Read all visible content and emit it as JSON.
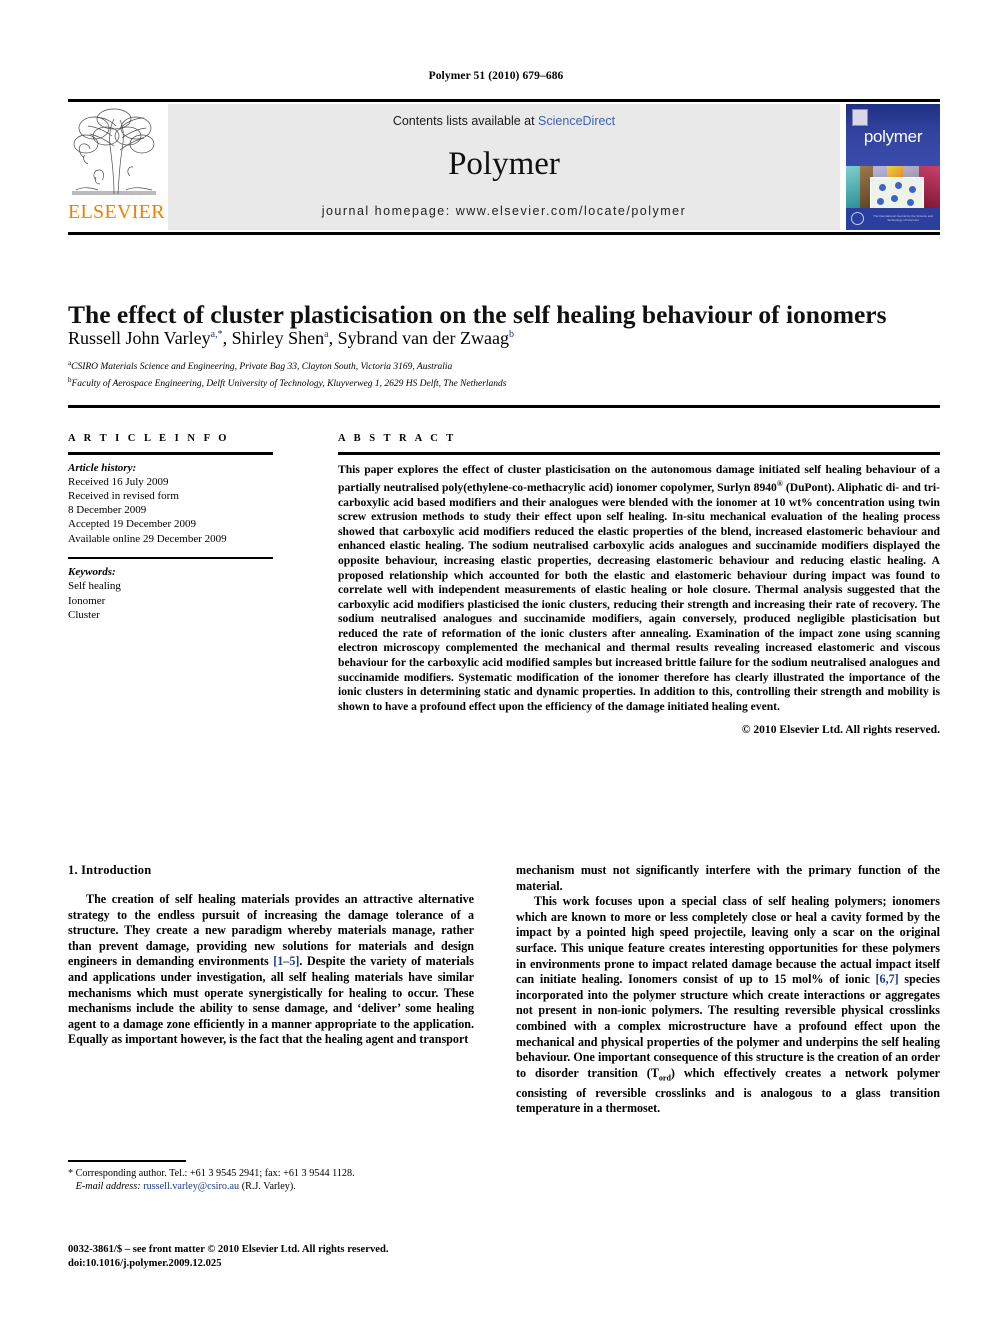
{
  "running_head": "Polymer 51 (2010) 679–686",
  "masthead": {
    "contents_prefix": "Contents lists available at ",
    "sciencedirect": "ScienceDirect",
    "journal_name": "Polymer",
    "homepage": "journal homepage: www.elsevier.com/locate/polymer",
    "publisher": "ELSEVIER",
    "cover_title": "polymer",
    "cover_footer": "The International Journal for the Science and Technology of Polymers",
    "link_color": "#3c63ae",
    "publisher_color": "#f08000",
    "banner_bg": "#e9e9e9",
    "cover_bg": "#2a3f9e"
  },
  "article": {
    "title": "The effect of cluster plasticisation on the self healing behaviour of ionomers",
    "authors": [
      {
        "name": "Russell John Varley",
        "marks": "a,*"
      },
      {
        "name": "Shirley Shen",
        "marks": "a"
      },
      {
        "name": "Sybrand van der Zwaag",
        "marks": "b"
      }
    ],
    "affiliations": [
      {
        "mark": "a",
        "text": "CSIRO Materials Science and Engineering, Private Bag 33, Clayton South, Victoria 3169, Australia"
      },
      {
        "mark": "b",
        "text": "Faculty of Aerospace Engineering, Delft University of Technology, Kluyverweg 1, 2629 HS Delft, The Netherlands"
      }
    ]
  },
  "info": {
    "heading": "A R T I C L E   I N F O",
    "history_label": "Article history:",
    "history": [
      "Received 16 July 2009",
      "Received in revised form",
      "8 December 2009",
      "Accepted 19 December 2009",
      "Available online 29 December 2009"
    ],
    "keywords_label": "Keywords:",
    "keywords": [
      "Self healing",
      "Ionomer",
      "Cluster"
    ]
  },
  "abstract": {
    "heading": "A B S T R A C T",
    "text_part1": "This paper explores the effect of cluster plasticisation on the autonomous damage initiated self healing behaviour of a partially neutralised poly(ethylene-co-methacrylic acid) ionomer copolymer, Surlyn 8940",
    "registered_mark": "®",
    "text_part2": " (DuPont). Aliphatic di- and tri-carboxylic acid based modifiers and their analogues were blended with the ionomer at 10 wt% concentration using twin screw extrusion methods to study their effect upon self healing. In-situ mechanical evaluation of the healing process showed that carboxylic acid modifiers reduced the elastic properties of the blend, increased elastomeric behaviour and enhanced elastic healing. The sodium neutralised carboxylic acids analogues and succinamide modifiers displayed the opposite behaviour, increasing elastic properties, decreasing elastomeric behaviour and reducing elastic healing. A proposed relationship which accounted for both the elastic and elastomeric behaviour during impact was found to correlate well with independent measurements of elastic healing or hole closure. Thermal analysis suggested that the carboxylic acid modifiers plasticised the ionic clusters, reducing their strength and increasing their rate of recovery. The sodium neutralised analogues and succinamide modifiers, again conversely, produced negligible plasticisation but reduced the rate of reformation of the ionic clusters after annealing. Examination of the impact zone using scanning electron microscopy complemented the mechanical and thermal results revealing increased elastomeric and viscous behaviour for the carboxylic acid modified samples but increased brittle failure for the sodium neutralised analogues and succinamide modifiers. Systematic modification of the ionomer therefore has clearly illustrated the importance of the ionic clusters in determining static and dynamic properties. In addition to this, controlling their strength and mobility is shown to have a profound effect upon the efficiency of the damage initiated healing event.",
    "copyright": "© 2010 Elsevier Ltd. All rights reserved."
  },
  "introduction": {
    "heading": "1. Introduction",
    "left_p1_a": "The creation of self healing materials provides an attractive alternative strategy to the endless pursuit of increasing the damage tolerance of a structure. They create a new paradigm whereby materials manage, rather than prevent damage, providing new solutions for materials and design engineers in demanding environments ",
    "left_ref1": "[1–5]",
    "left_p1_b": ". Despite the variety of materials and applications under investigation, all self healing materials have similar mechanisms which must operate synergistically for healing to occur. These mechanisms include the ability to sense damage, and ‘deliver’ some healing agent to a damage zone efficiently in a manner appropriate to the application. Equally as important however, is the fact that the healing agent and transport",
    "right_p1_cont": "mechanism must not significantly interfere with the primary function of the material.",
    "right_p2_a": "This work focuses upon a special class of self healing polymers; ionomers which are known to more or less completely close or heal a cavity formed by the impact by a pointed high speed projectile, leaving only a scar on the original surface. This unique feature creates interesting opportunities for these polymers in environments prone to impact related damage because the actual impact itself can initiate healing. Ionomers consist of up to 15 mol% of ionic ",
    "right_ref1": "[6,7]",
    "right_p2_b": " species incorporated into the polymer structure which create interactions or aggregates not present in non-ionic polymers. The resulting reversible physical crosslinks combined with a complex microstructure have a profound effect upon the mechanical and physical properties of the polymer and underpins the self healing behaviour. One important consequence of this structure is the creation of an order to disorder transition (T",
    "right_sub": "ord",
    "right_p2_c": ") which effectively creates a network polymer consisting of reversible crosslinks and is analogous to a glass transition temperature in a thermoset."
  },
  "footer": {
    "corresponding": "* Corresponding author. Tel.: +61 3 9545 2941; fax: +61 3 9544 1128.",
    "email_label": "E-mail address:",
    "email": "russell.varley@csiro.au",
    "email_suffix": "(R.J. Varley).",
    "issn_line": "0032-3861/$ – see front matter © 2010 Elsevier Ltd. All rights reserved.",
    "doi_line": "doi:10.1016/j.polymer.2009.12.025"
  }
}
